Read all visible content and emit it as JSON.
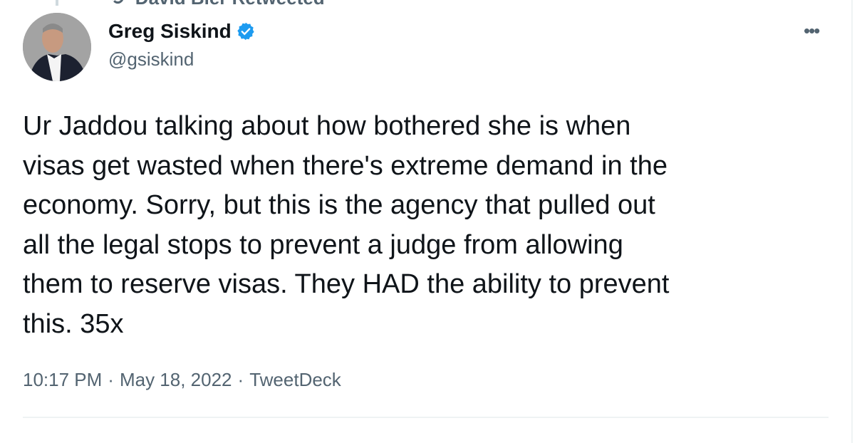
{
  "retweet_context": {
    "label": "David Bier Retweeted"
  },
  "author": {
    "name": "Greg Siskind",
    "handle": "@gsiskind",
    "verified": true,
    "badge_color": "#1d9bf0"
  },
  "tweet": {
    "text": "Ur Jaddou talking about how bothered she is when\nvisas get wasted when there's extreme demand in the\neconomy. Sorry, but this is the agency that pulled out\nall the legal stops to prevent a judge from allowing\nthem to reserve visas. They HAD the ability to prevent\nthis. 35x",
    "time": "10:17 PM",
    "date": "May 18, 2022",
    "source": "TweetDeck",
    "separator": "·"
  },
  "more_label": "•••"
}
